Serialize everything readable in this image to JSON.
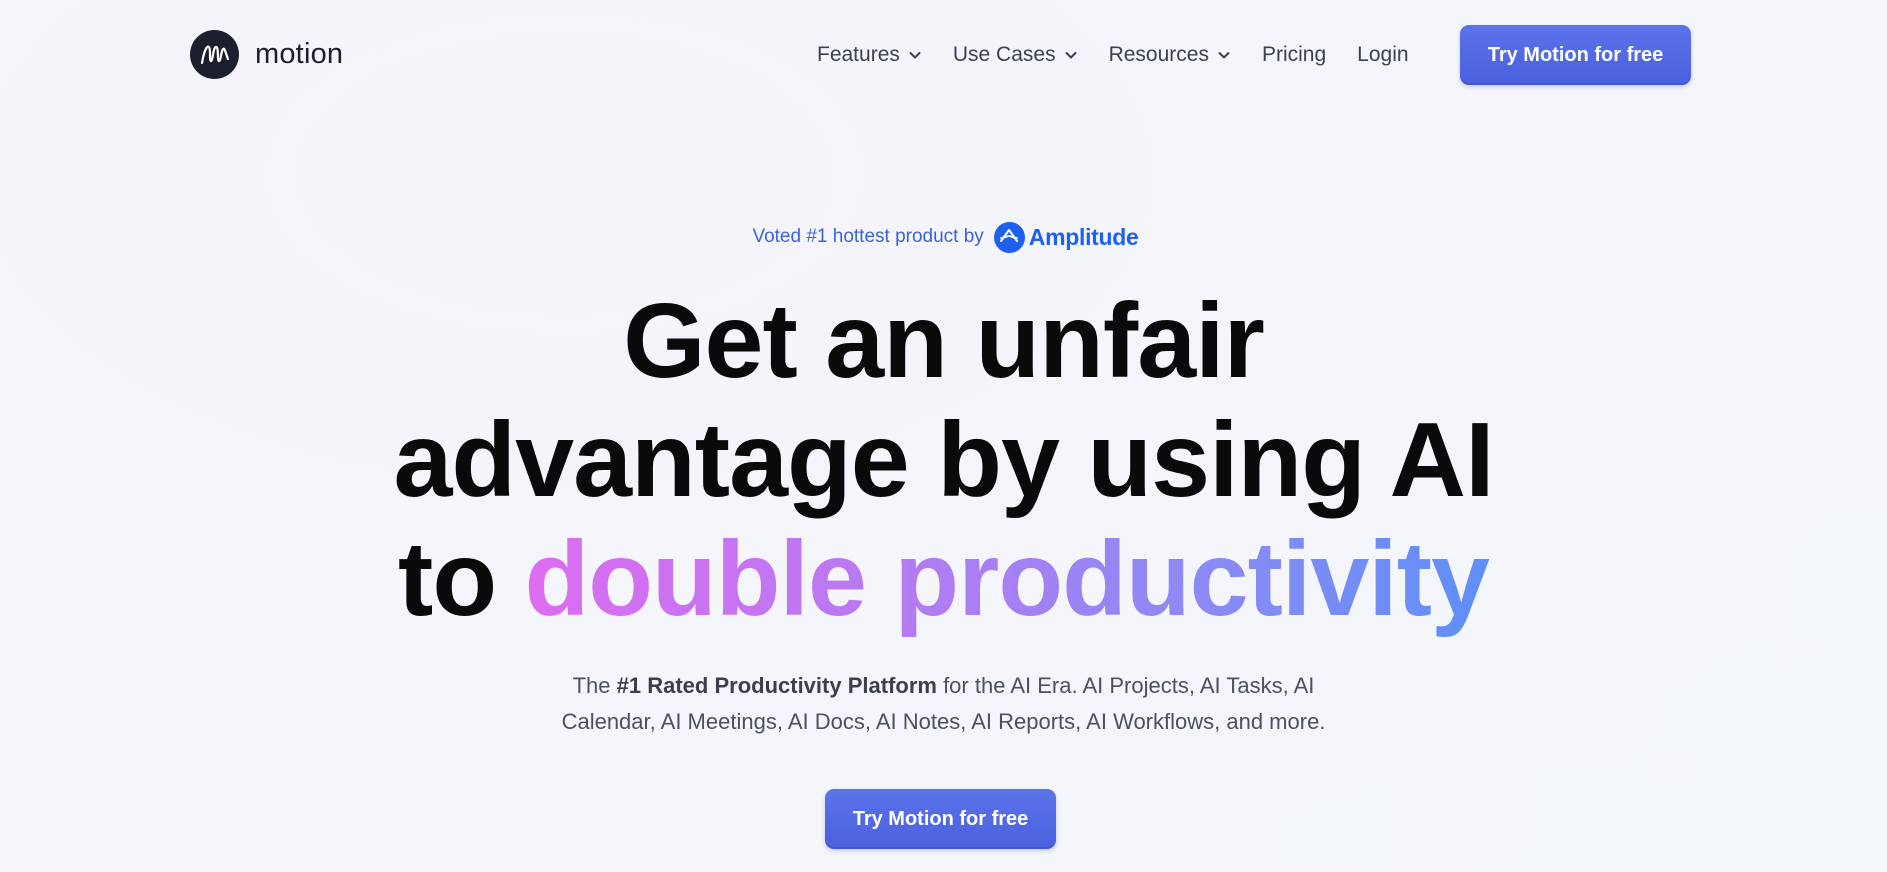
{
  "brand": {
    "name": "motion",
    "logo_icon": "motion-m-logo-icon"
  },
  "nav": {
    "items": [
      {
        "label": "Features",
        "has_dropdown": true
      },
      {
        "label": "Use Cases",
        "has_dropdown": true
      },
      {
        "label": "Resources",
        "has_dropdown": true
      },
      {
        "label": "Pricing",
        "has_dropdown": false
      },
      {
        "label": "Login",
        "has_dropdown": false
      }
    ],
    "cta_label": "Try Motion for free"
  },
  "hero": {
    "voted_text": "Voted #1 hottest product by",
    "voted_brand": "Amplitude",
    "voted_brand_icon": "amplitude-logo-icon",
    "headline_line1": "Get an unfair",
    "headline_line2": "advantage by using AI",
    "headline_line3_plain": "to ",
    "headline_line3_gradient": "double productivity",
    "subtitle_prefix": "The ",
    "subtitle_bold": "#1 Rated Productivity Platform",
    "subtitle_rest_line1": " for the AI Era. AI Projects, AI Tasks, AI",
    "subtitle_line2": "Calendar, AI Meetings, AI Docs, AI Notes, AI Reports, AI Workflows, and more.",
    "cta_label": "Try Motion for free"
  },
  "colors": {
    "accent": "#4f66e3",
    "brand_dark": "#1b1f2e",
    "amplitude_blue": "#1e61f0",
    "gradient_start": "#dd6cf0",
    "gradient_end": "#5f8ff7"
  }
}
